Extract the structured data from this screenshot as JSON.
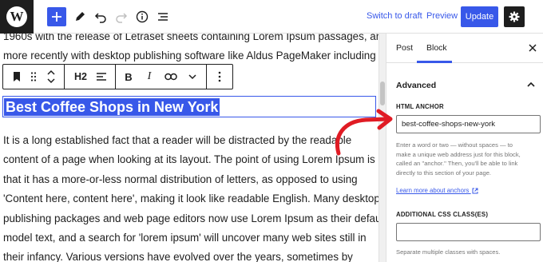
{
  "topbar": {
    "logo_letter": "W",
    "switch_to_draft": "Switch to draft",
    "preview": "Preview",
    "update": "Update"
  },
  "editor": {
    "intro_lines": [
      "1960s with the release of Letraset sheets containing Lorem Ipsum passages, and",
      "more recently with desktop publishing software like Aldus PageMaker including"
    ],
    "heading": "Best Coffee Shops in New York",
    "body_lines": [
      "It is a long established fact that a reader will be distracted by the readable",
      "content of a page when looking at its layout. The point of using Lorem Ipsum is",
      "that it has a more-or-less normal distribution of letters, as opposed to using",
      "'Content here, content here', making it look like readable English. Many desktop",
      "publishing packages and web page editors now use Lorem Ipsum as their default",
      "model text, and a search for 'lorem ipsum' will uncover many web sites still in",
      "their infancy. Various versions have evolved over the years, sometimes by"
    ]
  },
  "block_toolbar": {
    "heading_level": "H2",
    "bold": "B",
    "italic": "I"
  },
  "sidebar": {
    "tabs": [
      "Post",
      "Block"
    ],
    "active_tab": "Block",
    "advanced_title": "Advanced",
    "html_anchor_label": "HTML ANCHOR",
    "html_anchor_value": "best-coffee-shops-new-york",
    "anchor_help_lines": [
      "Enter a word or two — without spaces — to",
      "make a unique web address just for this block,",
      "called an \"anchor.\" Then, you'll be able to link",
      "directly to this section of your page."
    ],
    "learn_more": "Learn more about anchors",
    "css_label": "ADDITIONAL CSS CLASS(ES)",
    "css_value": "",
    "css_help": "Separate multiple classes with spaces."
  },
  "colors": {
    "accent": "#3858e9",
    "dark": "#1e1e1e",
    "annotation_arrow": "#e01b24"
  }
}
